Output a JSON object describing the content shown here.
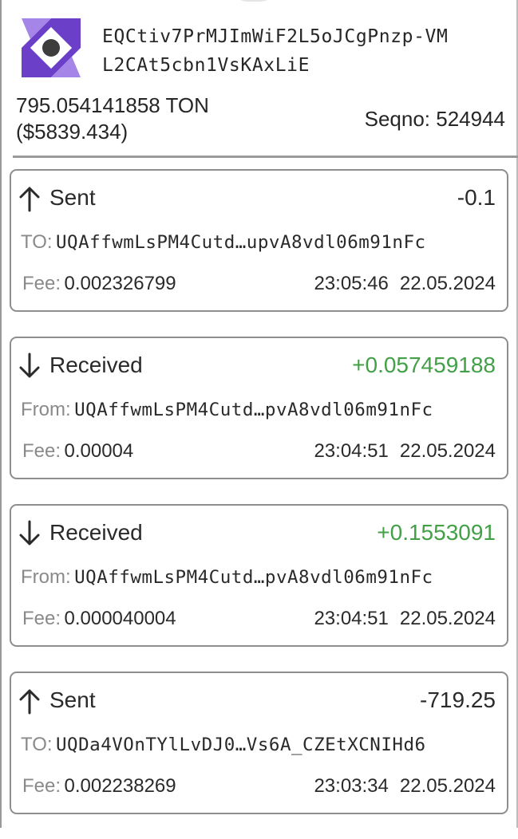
{
  "wallet": {
    "address_line1": "EQCtiv7PrMJImWiF2L5oJCgPnzp-VM",
    "address_line2": "L2CAt5cbn1VsKAxLiE",
    "balance_ton": "795.054141858 TON",
    "balance_usd": "($5839.434)",
    "seqno": "Seqno: 524944",
    "logo_icon": "ton-wallet-logo-icon",
    "logo_colors": {
      "purple": "#6b3fc8",
      "light": "#a585e8",
      "dot": "#3d3d3d"
    }
  },
  "colors": {
    "positive": "#43a047",
    "border": "#8e8e8e",
    "label": "#8a8a8a"
  },
  "transactions": [
    {
      "direction": "Sent",
      "icon": "arrow-up-icon",
      "amount": "-0.1",
      "positive": false,
      "party_label": "TO:",
      "party_address": "UQAffwmLsPM4Cutd…upvA8vdl06m91nFc",
      "fee_label": "Fee:",
      "fee": "0.002326799",
      "time": "23:05:46",
      "date": "22.05.2024"
    },
    {
      "direction": "Received",
      "icon": "arrow-down-icon",
      "amount": "+0.057459188",
      "positive": true,
      "party_label": "From:",
      "party_address": "UQAffwmLsPM4Cutd…pvA8vdl06m91nFc",
      "fee_label": "Fee:",
      "fee": "0.00004",
      "time": "23:04:51",
      "date": "22.05.2024"
    },
    {
      "direction": "Received",
      "icon": "arrow-down-icon",
      "amount": "+0.1553091",
      "positive": true,
      "party_label": "From:",
      "party_address": "UQAffwmLsPM4Cutd…pvA8vdl06m91nFc",
      "fee_label": "Fee:",
      "fee": "0.000040004",
      "time": "23:04:51",
      "date": "22.05.2024"
    },
    {
      "direction": "Sent",
      "icon": "arrow-up-icon",
      "amount": "-719.25",
      "positive": false,
      "party_label": "TO:",
      "party_address": "UQDa4VOnTYlLvDJ0…Vs6A_CZEtXCNIHd6",
      "fee_label": "Fee:",
      "fee": "0.002238269",
      "time": "23:03:34",
      "date": "22.05.2024"
    }
  ]
}
